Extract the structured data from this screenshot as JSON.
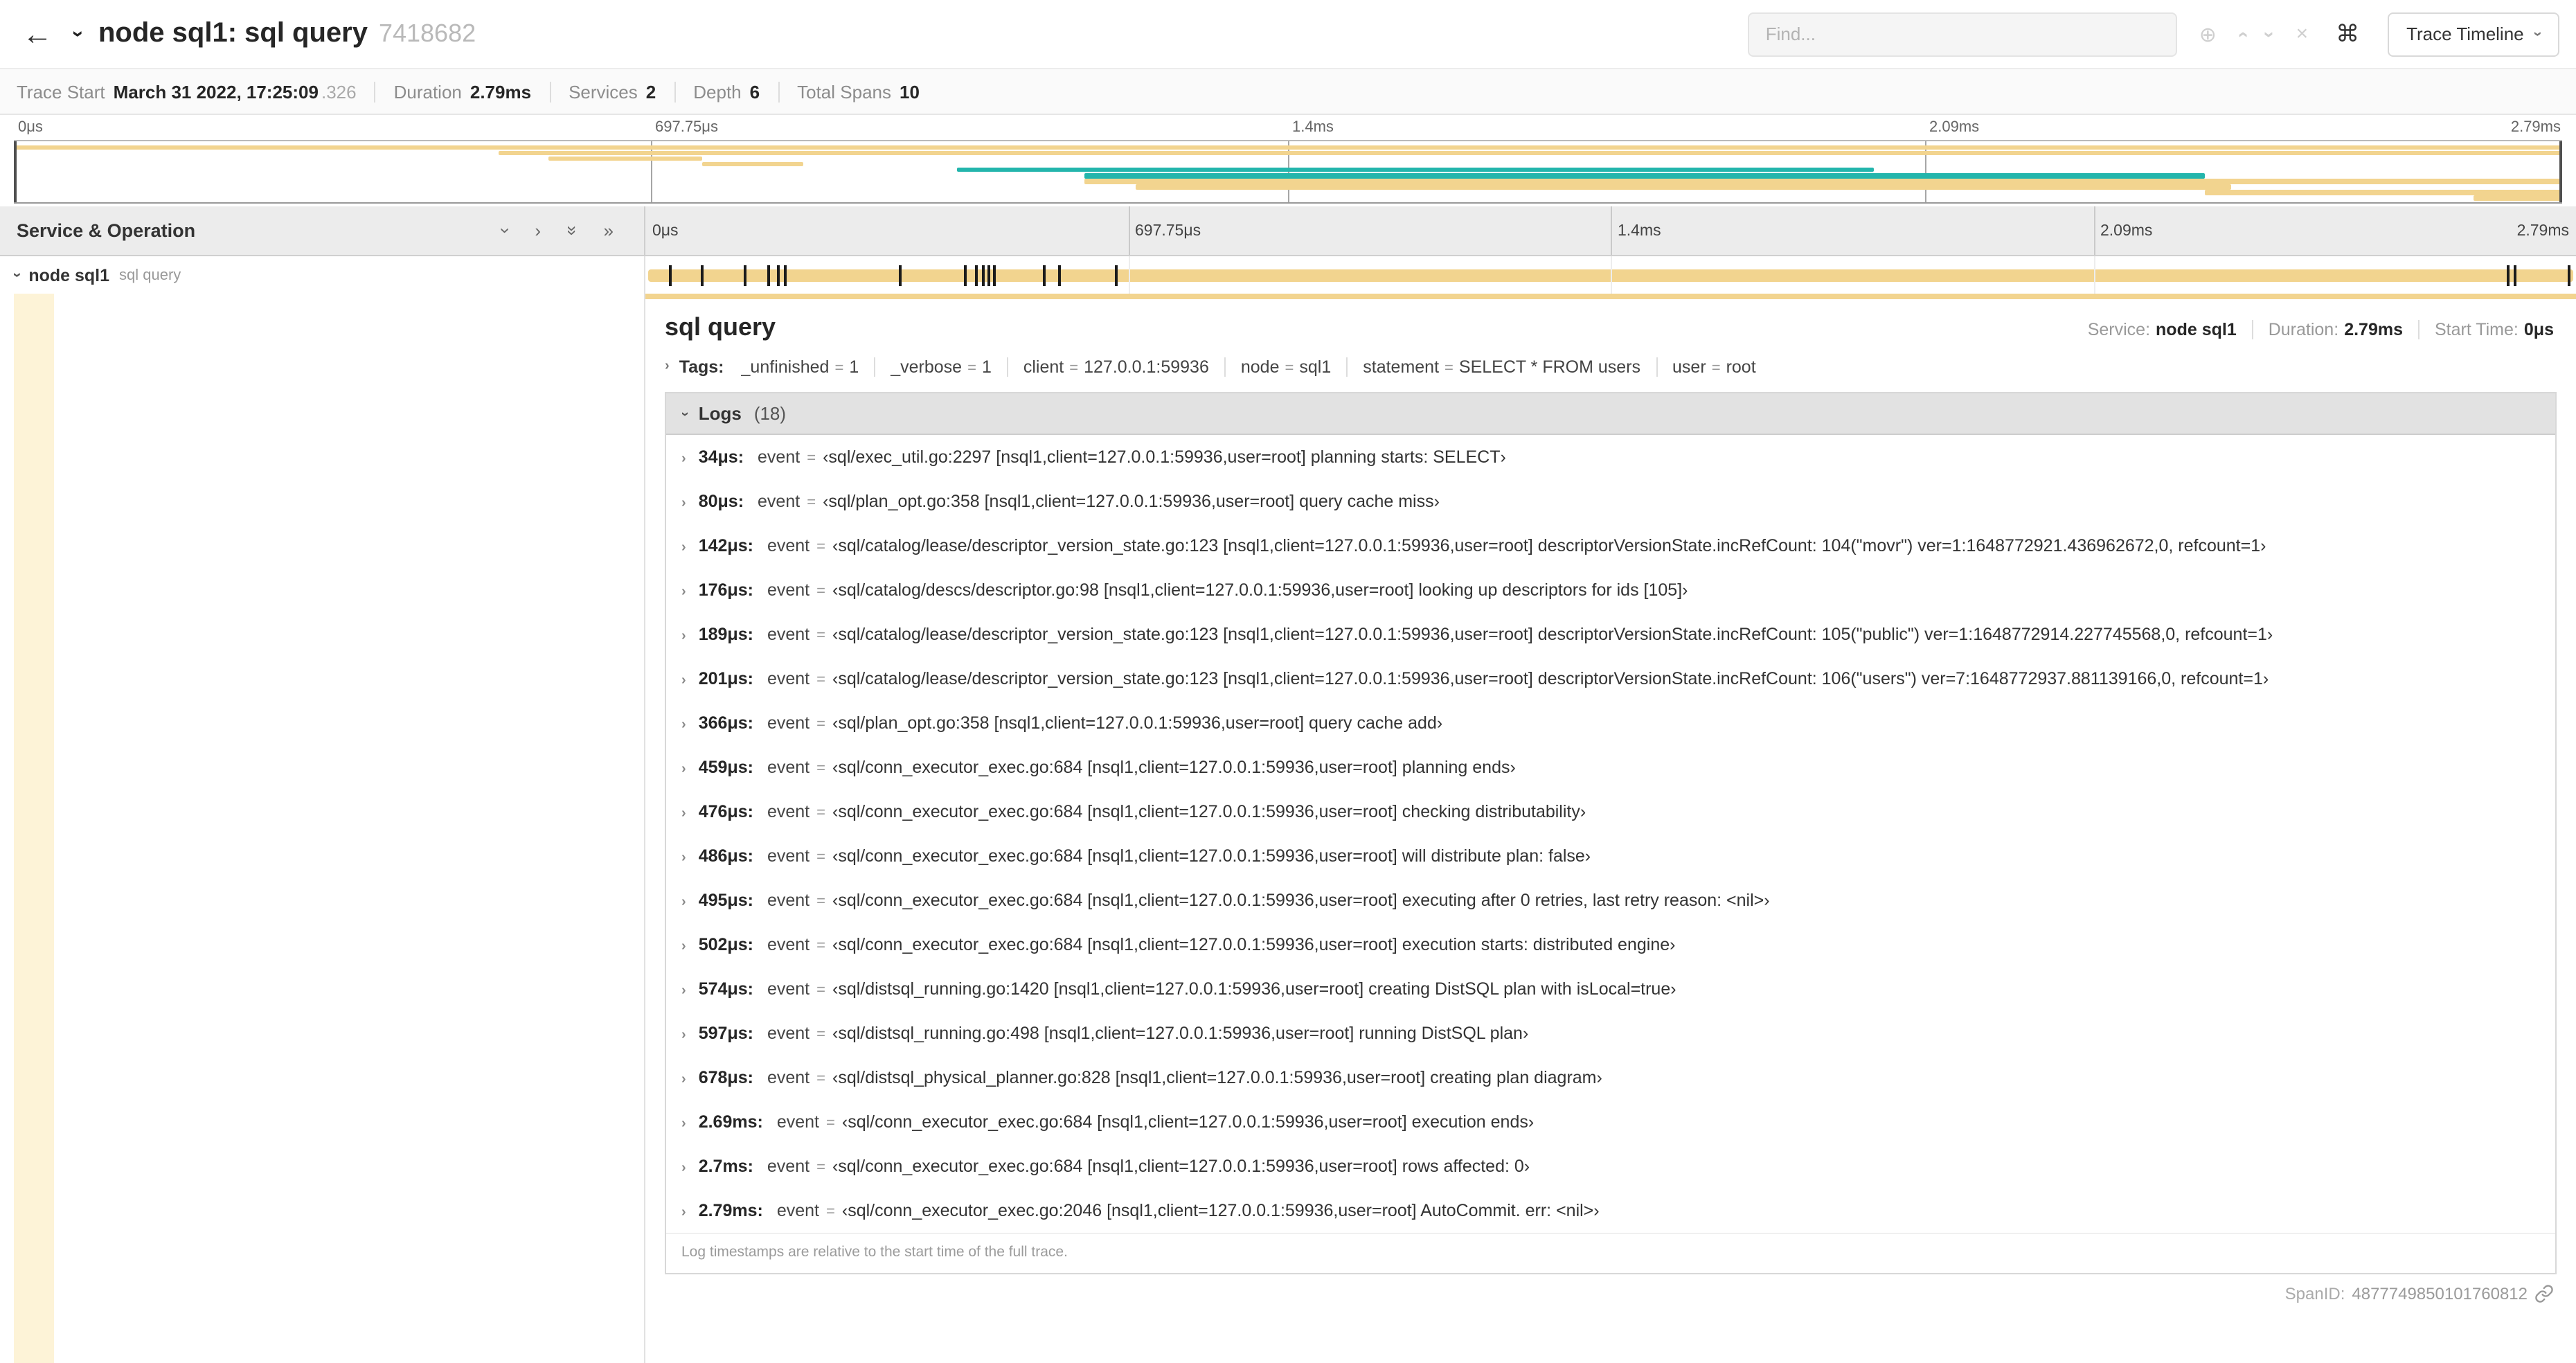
{
  "colors": {
    "span_tan": "#f2d48f",
    "span_tan_tint": "#fdf3d7",
    "span_teal": "#23b5ac",
    "log_tick": "#1b1b1b"
  },
  "icons": {
    "back": "←",
    "chevron": "›",
    "double_chevron": "»",
    "close": "×",
    "locate": "⊕",
    "command": "⌘"
  },
  "header": {
    "title": "node sql1: sql query",
    "trace_id": "7418682",
    "find_placeholder": "Find...",
    "view_button": "Trace Timeline"
  },
  "summary": {
    "items": [
      {
        "label": "Trace Start",
        "value": "March 31 2022, 17:25:09",
        "suffix": ".326"
      },
      {
        "label": "Duration",
        "value": "2.79ms"
      },
      {
        "label": "Services",
        "value": "2"
      },
      {
        "label": "Depth",
        "value": "6"
      },
      {
        "label": "Total Spans",
        "value": "10"
      }
    ]
  },
  "minimap": {
    "ticks": [
      "0μs",
      "697.75μs",
      "1.4ms",
      "2.09ms",
      "2.79ms"
    ],
    "spans": [
      {
        "row": 0,
        "start": 0,
        "end": 100,
        "color": "tan"
      },
      {
        "row": 1,
        "start": 19,
        "end": 100,
        "color": "tan"
      },
      {
        "row": 2,
        "start": 21,
        "end": 27,
        "color": "tan"
      },
      {
        "row": 3,
        "start": 27,
        "end": 31,
        "color": "tan"
      },
      {
        "row": 4,
        "start": 37,
        "end": 73,
        "color": "teal"
      },
      {
        "row": 5,
        "start": 42,
        "end": 86,
        "color": "teal"
      },
      {
        "row": 6,
        "start": 42,
        "end": 100,
        "color": "tan"
      },
      {
        "row": 7,
        "start": 44,
        "end": 87,
        "color": "tan"
      },
      {
        "row": 8,
        "start": 86,
        "end": 100,
        "color": "tan"
      },
      {
        "row": 9,
        "start": 96.5,
        "end": 100,
        "color": "tan"
      }
    ]
  },
  "timeline": {
    "left_header": "Service & Operation",
    "ticks": [
      "0μs",
      "697.75μs",
      "1.4ms",
      "2.09ms",
      "2.79ms"
    ],
    "row": {
      "service": "node sql1",
      "operation": "sql query"
    },
    "log_marker_percents": [
      1.2,
      2.9,
      5.1,
      6.3,
      6.8,
      7.2,
      13.1,
      16.5,
      17.1,
      17.4,
      17.7,
      18.0,
      20.6,
      21.4,
      24.3,
      96.4,
      96.8,
      99.6
    ]
  },
  "detail": {
    "title": "sql query",
    "meta": [
      {
        "label": "Service:",
        "value": "node sql1"
      },
      {
        "label": "Duration:",
        "value": "2.79ms"
      },
      {
        "label": "Start Time:",
        "value": "0μs"
      }
    ],
    "tags_label": "Tags:",
    "tags": [
      {
        "key": "_unfinished",
        "value": "1"
      },
      {
        "key": "_verbose",
        "value": "1"
      },
      {
        "key": "client",
        "value": "127.0.0.1:59936"
      },
      {
        "key": "node",
        "value": "sql1"
      },
      {
        "key": "statement",
        "value": "SELECT * FROM users"
      },
      {
        "key": "user",
        "value": "root"
      }
    ],
    "logs_label": "Logs",
    "logs_count": "(18)",
    "logs": [
      {
        "time": "34μs:",
        "key": "event",
        "value": "‹sql/exec_util.go:2297 [nsql1,client=127.0.0.1:59936,user=root] planning starts: SELECT›"
      },
      {
        "time": "80μs:",
        "key": "event",
        "value": "‹sql/plan_opt.go:358 [nsql1,client=127.0.0.1:59936,user=root] query cache miss›"
      },
      {
        "time": "142μs:",
        "key": "event",
        "value": "‹sql/catalog/lease/descriptor_version_state.go:123 [nsql1,client=127.0.0.1:59936,user=root] descriptorVersionState.incRefCount: 104(\"movr\") ver=1:1648772921.436962672,0, refcount=1›"
      },
      {
        "time": "176μs:",
        "key": "event",
        "value": "‹sql/catalog/descs/descriptor.go:98 [nsql1,client=127.0.0.1:59936,user=root] looking up descriptors for ids [105]›"
      },
      {
        "time": "189μs:",
        "key": "event",
        "value": "‹sql/catalog/lease/descriptor_version_state.go:123 [nsql1,client=127.0.0.1:59936,user=root] descriptorVersionState.incRefCount: 105(\"public\") ver=1:1648772914.227745568,0, refcount=1›"
      },
      {
        "time": "201μs:",
        "key": "event",
        "value": "‹sql/catalog/lease/descriptor_version_state.go:123 [nsql1,client=127.0.0.1:59936,user=root] descriptorVersionState.incRefCount: 106(\"users\") ver=7:1648772937.881139166,0, refcount=1›"
      },
      {
        "time": "366μs:",
        "key": "event",
        "value": "‹sql/plan_opt.go:358 [nsql1,client=127.0.0.1:59936,user=root] query cache add›"
      },
      {
        "time": "459μs:",
        "key": "event",
        "value": "‹sql/conn_executor_exec.go:684 [nsql1,client=127.0.0.1:59936,user=root] planning ends›"
      },
      {
        "time": "476μs:",
        "key": "event",
        "value": "‹sql/conn_executor_exec.go:684 [nsql1,client=127.0.0.1:59936,user=root] checking distributability›"
      },
      {
        "time": "486μs:",
        "key": "event",
        "value": "‹sql/conn_executor_exec.go:684 [nsql1,client=127.0.0.1:59936,user=root] will distribute plan: false›"
      },
      {
        "time": "495μs:",
        "key": "event",
        "value": "‹sql/conn_executor_exec.go:684 [nsql1,client=127.0.0.1:59936,user=root] executing after 0 retries, last retry reason: <nil>›"
      },
      {
        "time": "502μs:",
        "key": "event",
        "value": "‹sql/conn_executor_exec.go:684 [nsql1,client=127.0.0.1:59936,user=root] execution starts: distributed engine›"
      },
      {
        "time": "574μs:",
        "key": "event",
        "value": "‹sql/distsql_running.go:1420 [nsql1,client=127.0.0.1:59936,user=root] creating DistSQL plan with isLocal=true›"
      },
      {
        "time": "597μs:",
        "key": "event",
        "value": "‹sql/distsql_running.go:498 [nsql1,client=127.0.0.1:59936,user=root] running DistSQL plan›"
      },
      {
        "time": "678μs:",
        "key": "event",
        "value": "‹sql/distsql_physical_planner.go:828 [nsql1,client=127.0.0.1:59936,user=root] creating plan diagram›"
      },
      {
        "time": "2.69ms:",
        "key": "event",
        "value": "‹sql/conn_executor_exec.go:684 [nsql1,client=127.0.0.1:59936,user=root] execution ends›"
      },
      {
        "time": "2.7ms:",
        "key": "event",
        "value": "‹sql/conn_executor_exec.go:684 [nsql1,client=127.0.0.1:59936,user=root] rows affected: 0›"
      },
      {
        "time": "2.79ms:",
        "key": "event",
        "value": "‹sql/conn_executor_exec.go:2046 [nsql1,client=127.0.0.1:59936,user=root] AutoCommit. err: <nil>›"
      }
    ],
    "logs_note": "Log timestamps are relative to the start time of the full trace.",
    "span_id_label": "SpanID:",
    "span_id": "4877749850101760812"
  }
}
